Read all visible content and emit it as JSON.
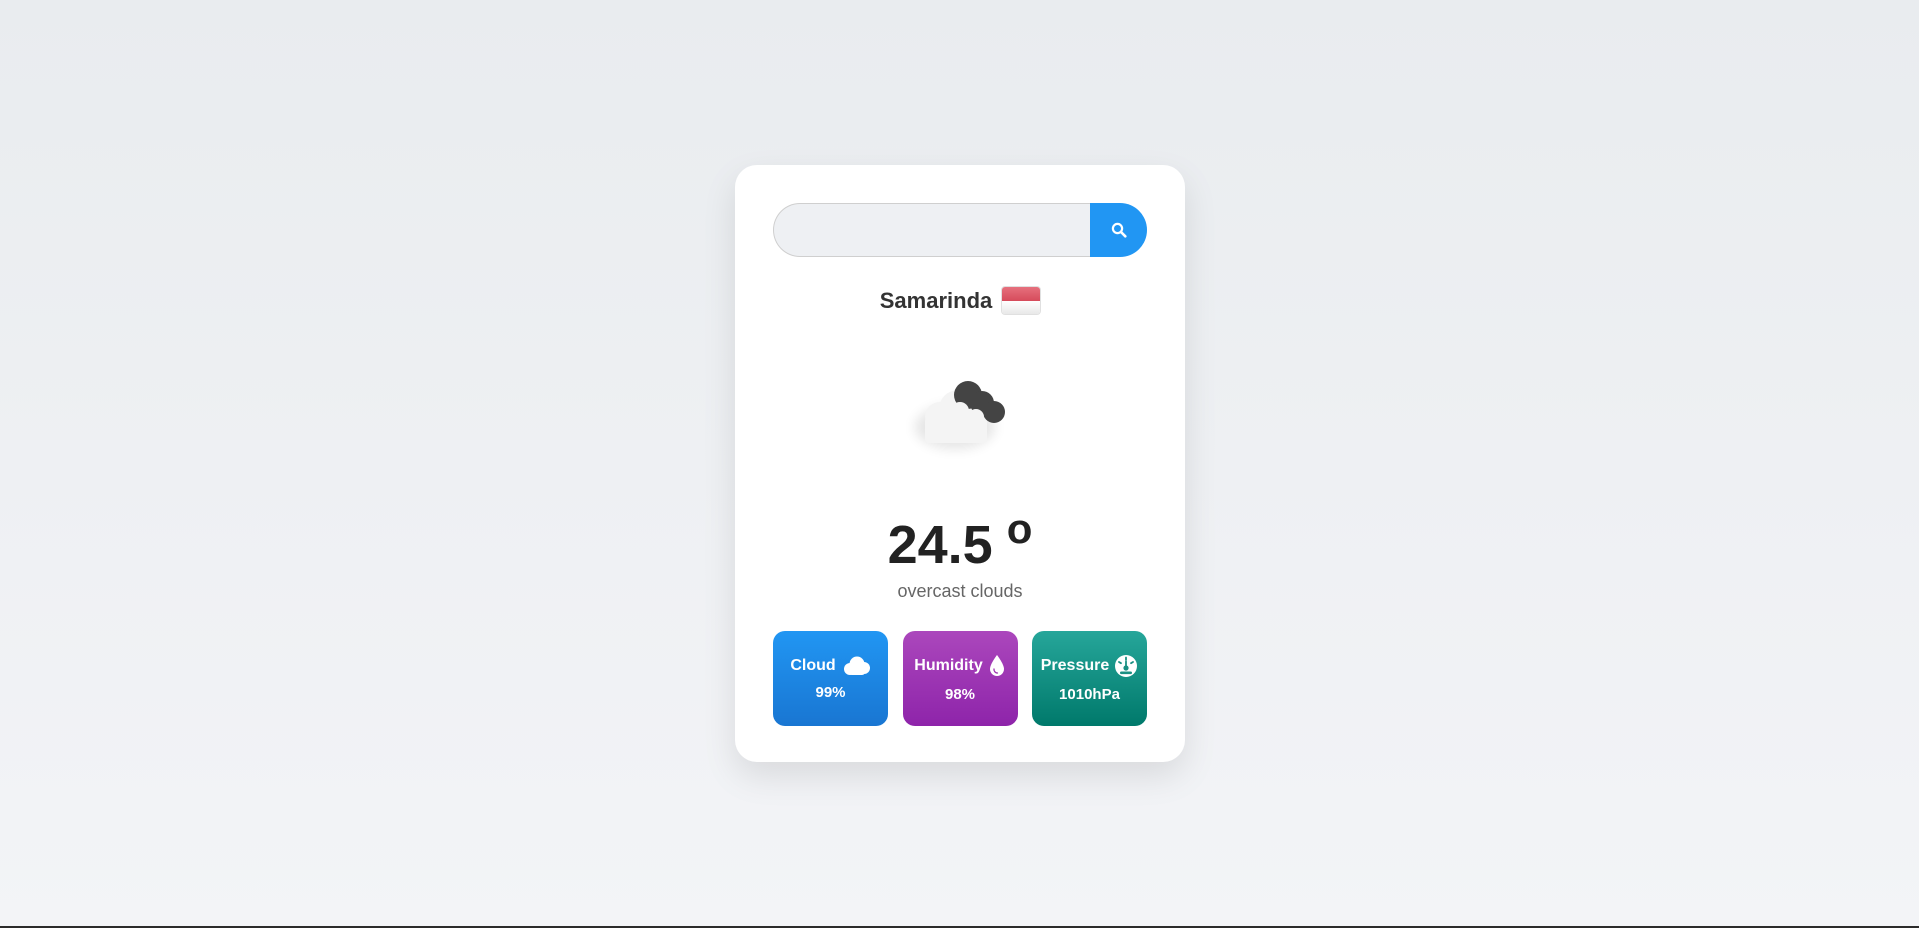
{
  "search": {
    "placeholder": "",
    "value": "",
    "button_icon": "search-icon"
  },
  "location": {
    "city": "Samarinda",
    "flag_icon": "indonesia-flag-icon"
  },
  "weather": {
    "icon": "overcast-clouds-icon",
    "temperature": "24.5",
    "degree_symbol": "o",
    "description": "overcast clouds"
  },
  "stats": {
    "cloud": {
      "label": "Cloud",
      "value": "99%",
      "icon": "cloud-icon",
      "color": "#2196f3"
    },
    "humidity": {
      "label": "Humidity",
      "value": "98%",
      "icon": "water-drop-icon",
      "color": "#ab47bc"
    },
    "pressure": {
      "label": "Pressure",
      "value": "1010hPa",
      "icon": "gauge-icon",
      "color": "#26a69a"
    }
  },
  "colors": {
    "accent": "#2196f3",
    "background": "#eceef1",
    "card": "#ffffff"
  }
}
